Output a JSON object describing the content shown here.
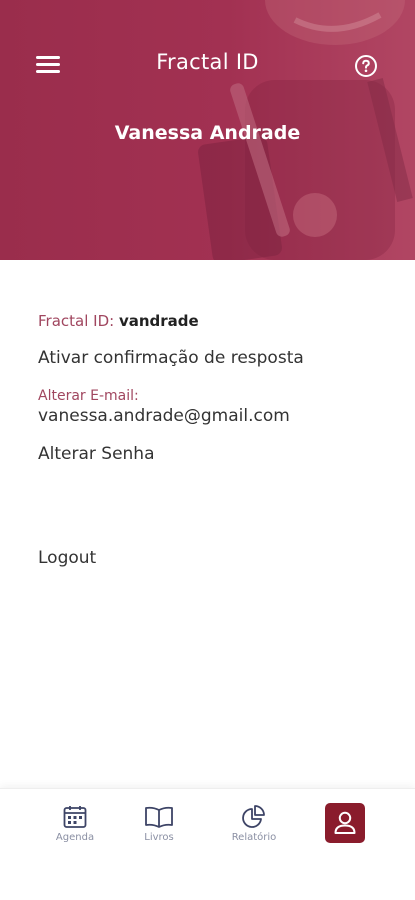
{
  "header": {
    "app_title": "Fractal ID",
    "user_name": "Vanessa Andrade",
    "menu_icon": "hamburger-icon",
    "help_icon": "question-circle-icon",
    "background_color": "#a23152"
  },
  "profile": {
    "fractal_id_label": "Fractal ID:",
    "fractal_id_value": "vandrade",
    "confirm_answer": "Ativar confirmação de resposta",
    "email_label": "Alterar E-mail:",
    "email_value": "vanessa.andrade@gmail.com",
    "change_password": "Alterar Senha",
    "logout": "Logout"
  },
  "bottom_nav": {
    "items": [
      {
        "label": "Agenda",
        "icon": "calendar-icon"
      },
      {
        "label": "Livros",
        "icon": "open-book-icon"
      },
      {
        "label": "Relatório",
        "icon": "pie-chart-icon"
      },
      {
        "label": "",
        "icon": "user-icon",
        "active": true
      }
    ],
    "active_color": "#8a1c2c",
    "icon_color": "#3d4466"
  }
}
